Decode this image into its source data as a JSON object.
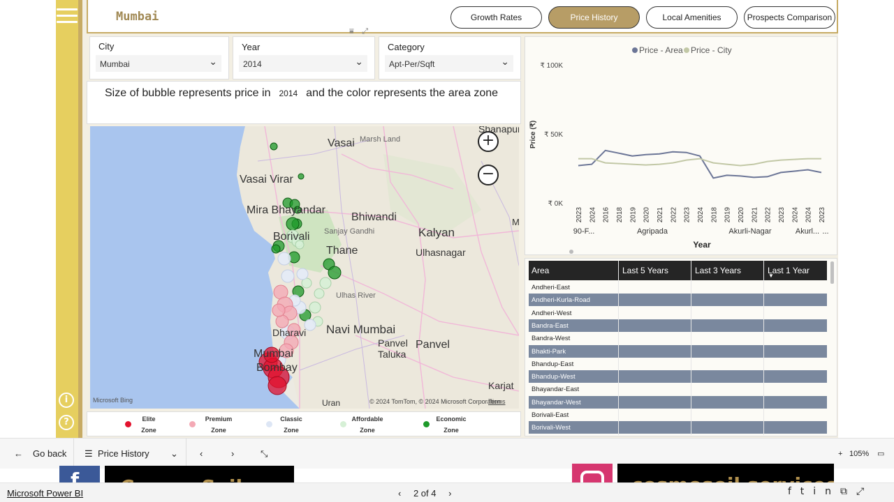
{
  "header": {
    "city_title": "Mumbai",
    "nav": [
      {
        "label": "Growth Rates",
        "active": false
      },
      {
        "label": "Price History",
        "active": true
      },
      {
        "label": "Local Amenities",
        "active": false
      },
      {
        "label": "Prospects Comparison",
        "active": false
      }
    ]
  },
  "slicers": {
    "city": {
      "label": "City",
      "value": "Mumbai"
    },
    "year": {
      "label": "Year",
      "value": "2014"
    },
    "category": {
      "label": "Category",
      "value": "Apt-Per/Sqft"
    }
  },
  "subtitle": {
    "before": "Size of bubble represents price in",
    "year": "2014",
    "after": "and the color represents the area zone"
  },
  "map": {
    "labels": [
      "Vasai",
      "Marsh Land",
      "Shanapur",
      "Vasai Virar",
      "Mira Bhayandar",
      "Bhiwandi",
      "Kalyan",
      "Ulhasnagar",
      "Sanjay Gandhi",
      "Thane",
      "Borivali",
      "Ulhas River",
      "Navi Mumbai",
      "Panvel Taluka",
      "Panvel",
      "Karjat",
      "Mumbai",
      "Bombay",
      "Uran",
      "Dharavi",
      "M"
    ],
    "bing": "Microsoft Bing",
    "attribution": "© 2024 TomTom, © 2024 Microsoft Corporation",
    "terms": "Terms",
    "zoom_in": "+",
    "zoom_out": "−"
  },
  "legend": {
    "items": [
      {
        "line1": "Elite",
        "line2": "Zone",
        "color": "#e3122e"
      },
      {
        "line1": "Premium",
        "line2": "Zone",
        "color": "#f4a9b5"
      },
      {
        "line1": "Classic",
        "line2": "Zone",
        "color": "#dde6f5"
      },
      {
        "line1": "Affordable",
        "line2": "Zone",
        "color": "#d6f0d6"
      },
      {
        "line1": "Economic",
        "line2": "Zone",
        "color": "#1e9a2a"
      }
    ]
  },
  "chart_data": {
    "type": "line",
    "legend": [
      "Price - Area",
      "Price - City"
    ],
    "legend_position": "top",
    "colors": {
      "Price - Area": "#6b7596",
      "Price - City": "#c2c8a6"
    },
    "ylabel": "Price (₹)",
    "xlabel": "Year",
    "yticks": [
      "₹ 100K",
      "₹ 50K",
      "₹ 0K"
    ],
    "ylim": [
      0,
      100000
    ],
    "x": [
      "2023",
      "2024",
      "2016",
      "2018",
      "2019",
      "2020",
      "2021",
      "2022",
      "2023",
      "2024",
      "2018",
      "2019",
      "2020",
      "2021",
      "2022",
      "2023",
      "2024",
      "2024",
      "2023"
    ],
    "groups": [
      "90-F...",
      "Agripada",
      "Akurli-Nagar",
      "Akurl...",
      "..."
    ],
    "series": [
      {
        "name": "Price - Area",
        "values": [
          27000,
          28000,
          38000,
          36000,
          34000,
          35000,
          35500,
          37000,
          36500,
          34000,
          18000,
          20000,
          19500,
          18500,
          19000,
          22000,
          23000,
          24000,
          22000
        ]
      },
      {
        "name": "Price - City",
        "values": [
          32000,
          32000,
          29000,
          28500,
          28000,
          27500,
          28000,
          29000,
          31000,
          32000,
          29000,
          28000,
          27000,
          28000,
          30000,
          31000,
          31500,
          32000,
          32000
        ]
      }
    ]
  },
  "table": {
    "columns": [
      "Area",
      "Last 5 Years",
      "Last 3 Years",
      "Last 1 Year"
    ],
    "sort_indicator": "▼",
    "rows": [
      "Andheri-East",
      "Andheri-Kurla-Road",
      "Andheri-West",
      "Bandra-East",
      "Bandra-West",
      "Bhakti-Park",
      "Bhandup-East",
      "Bhandup-West",
      "Bhayandar-East",
      "Bhayandar-West",
      "Borivali-East",
      "Borivali-West"
    ]
  },
  "bottom_bar": {
    "go_back": "Go back",
    "page_name": "Price History",
    "zoom": "105%"
  },
  "promo": {
    "left": "Cosmo-Soil.com",
    "right": "cosmosoil services"
  },
  "status": {
    "brand": "Microsoft Power BI",
    "pager": "2 of 4"
  }
}
